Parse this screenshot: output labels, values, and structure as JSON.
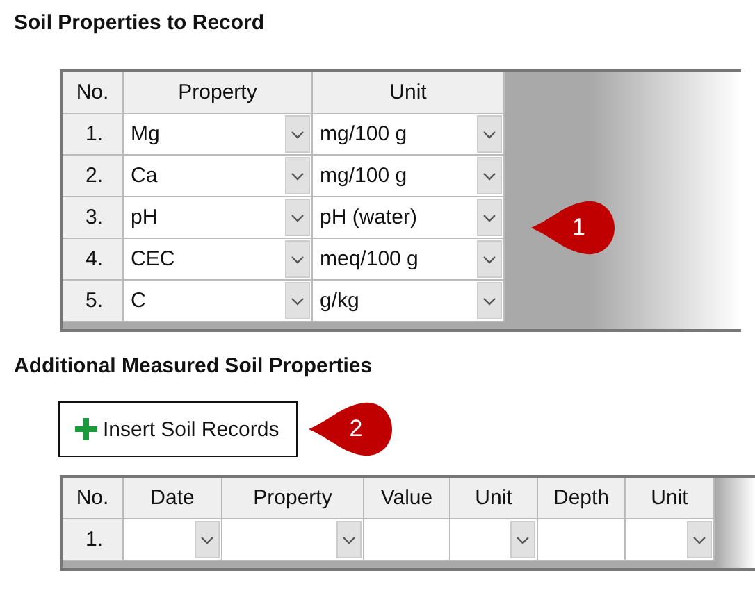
{
  "sections": [
    {
      "title": "Soil Properties to Record",
      "callout": "1",
      "columns": [
        {
          "label": "No.",
          "kind": "number"
        },
        {
          "label": "Property",
          "kind": "combo"
        },
        {
          "label": "Unit",
          "kind": "combo"
        }
      ],
      "rows": [
        {
          "cells": [
            "1.",
            "Mg",
            "mg/100 g"
          ]
        },
        {
          "cells": [
            "2.",
            "Ca",
            "mg/100 g"
          ]
        },
        {
          "cells": [
            "3.",
            "pH",
            "pH (water)"
          ]
        },
        {
          "cells": [
            "4.",
            "CEC",
            "meq/100 g"
          ]
        },
        {
          "cells": [
            "5.",
            "C",
            "g/kg"
          ]
        }
      ]
    },
    {
      "title": "Additional Measured Soil Properties",
      "button": {
        "label": "Insert Soil Records"
      },
      "callout": "2",
      "columns": [
        {
          "label": "No.",
          "kind": "number"
        },
        {
          "label": "Date",
          "kind": "combo"
        },
        {
          "label": "Property",
          "kind": "combo"
        },
        {
          "label": "Value",
          "kind": "text"
        },
        {
          "label": "Unit",
          "kind": "combo"
        },
        {
          "label": "Depth",
          "kind": "text"
        },
        {
          "label": "Unit",
          "kind": "combo"
        }
      ],
      "rows": [
        {
          "cells": [
            "1.",
            "",
            "",
            "",
            "",
            "",
            ""
          ]
        }
      ]
    }
  ]
}
